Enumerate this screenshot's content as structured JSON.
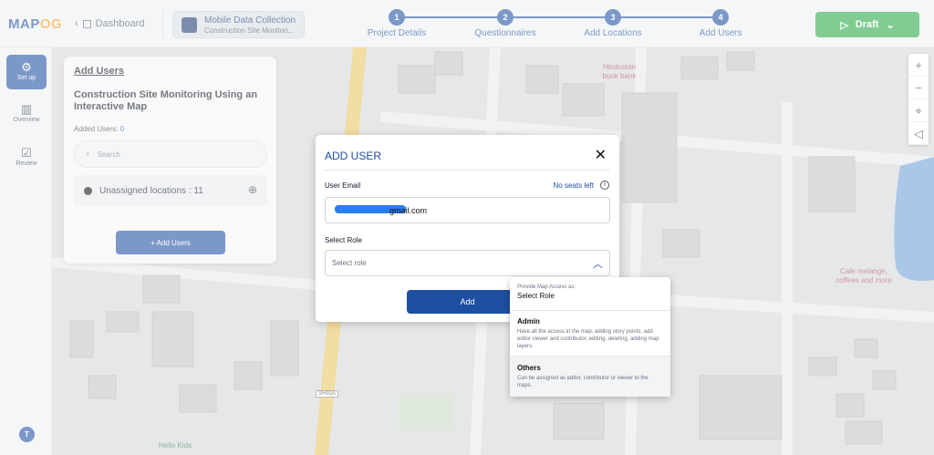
{
  "app": {
    "logo_prefix": "MAP",
    "logo_accent": "OG"
  },
  "header": {
    "back_label": "Dashboard",
    "project_title": "Mobile Data Collection",
    "project_subtitle": "Construction Site Monitori...",
    "steps": [
      {
        "num": "1",
        "label": "Project Details"
      },
      {
        "num": "2",
        "label": "Questionnaires"
      },
      {
        "num": "3",
        "label": "Add Locations"
      },
      {
        "num": "4",
        "label": "Add Users"
      }
    ],
    "draft_label": "Draft"
  },
  "sidebar": {
    "items": [
      {
        "label": "Set up",
        "icon": "gear-icon"
      },
      {
        "label": "Overview",
        "icon": "bar-chart-icon"
      },
      {
        "label": "Review",
        "icon": "checkbox-icon"
      }
    ],
    "avatar_initial": "T"
  },
  "panel": {
    "title": "Add Users",
    "project_name": "Construction Site Monitoring Using an Interactive Map",
    "added_users_label": "Added Users:",
    "added_users_count": "0",
    "search_placeholder": "Search",
    "unassigned_label": "Unassigned locations : 11",
    "add_button": "+ Add Users"
  },
  "map": {
    "labels": {
      "bank": "Hindustan book bank",
      "cafe": "Cafe melange, coffees and more",
      "kids": "Hello Kids",
      "road": "SH93A"
    },
    "zoom": [
      "+",
      "−",
      "⌖",
      "◁"
    ]
  },
  "modal": {
    "title": "ADD USER",
    "email_label": "User Email",
    "seats_label": "No seats left",
    "email_value": "gmail.com",
    "role_label": "Select Role",
    "role_placeholder": "Select role",
    "submit_label": "Add"
  },
  "dropdown": {
    "hint": "Provide Map Access as:",
    "selected": "Select Role",
    "options": [
      {
        "name": "Admin",
        "desc": "Have all the access in the map, adding story points, add editor viewer and contributor, editing, deleting, adding map layers."
      },
      {
        "name": "Others",
        "desc": "Can be assigned as editor, contributor or viewer to the maps."
      }
    ]
  },
  "colors": {
    "primary": "#1e4fa0",
    "draft": "#27a844",
    "water": "#6f9fd8"
  }
}
